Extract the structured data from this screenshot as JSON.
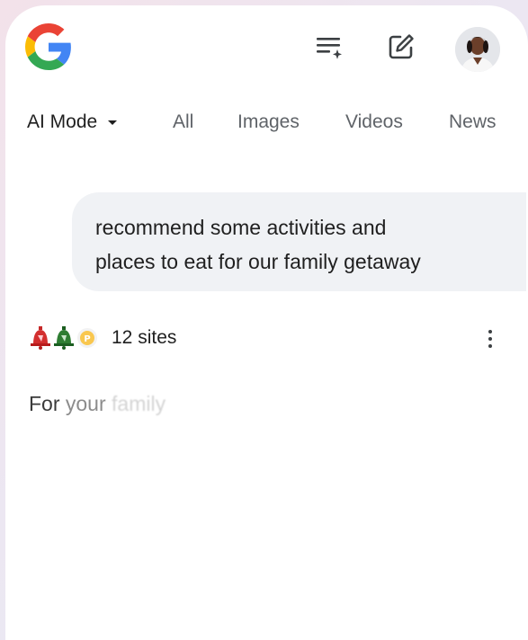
{
  "header": {
    "logo_letter": "G",
    "icons": [
      "history-sparkle-icon",
      "edit-icon",
      "profile-avatar"
    ]
  },
  "tabs": [
    {
      "label": "AI Mode",
      "active": true
    },
    {
      "label": "All",
      "active": false
    },
    {
      "label": "Images",
      "active": false
    },
    {
      "label": "Videos",
      "active": false
    },
    {
      "label": "News",
      "active": false
    }
  ],
  "query": {
    "line1": "recommend some activities and",
    "line2": "places to eat for our family getaway"
  },
  "sources": {
    "count_label": "12 sites",
    "favicons": [
      "red-bell-icon",
      "green-bell-icon",
      "yellow-p-icon"
    ]
  },
  "response": {
    "word1": "For",
    "word2": "your",
    "word3": "family"
  },
  "colors": {
    "google_blue": "#4285F4",
    "google_red": "#EA4335",
    "google_yellow": "#FBBC05",
    "google_green": "#34A853",
    "bubble_bg": "#f0f2f5"
  }
}
